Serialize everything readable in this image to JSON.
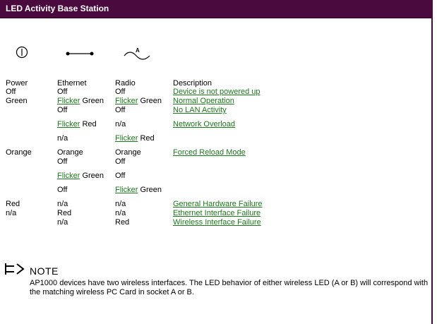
{
  "title": "LED Activity Base Station",
  "icons": [
    "power-icon",
    "ethernet-icon",
    "radio-icon"
  ],
  "radio_icon_letter": "A",
  "headers": {
    "power": "Power",
    "ethernet": "Ethernet",
    "radio": "Radio",
    "description": "Description"
  },
  "rows": [
    {
      "power": "Off",
      "eth_a": "",
      "eth_b": "Off",
      "radio_a": "",
      "radio_b": "Off",
      "desc": "Device is not powered up"
    },
    {
      "power": "Green",
      "eth_a": "Flicker",
      "eth_b": "Green",
      "radio_a": "Flicker",
      "radio_b": "Green",
      "desc": "Normal Operation"
    },
    {
      "power": "",
      "eth_a": "",
      "eth_b": "Off",
      "radio_a": "",
      "radio_b": "Off",
      "desc": "No LAN Activity"
    },
    {
      "power": "",
      "eth_a": "Flicker",
      "eth_b": "Red",
      "radio_a": "",
      "radio_b": "n/a",
      "desc": "Network Overload"
    },
    {
      "power": "",
      "eth_a": "",
      "eth_b": "n/a",
      "radio_a": "Flicker",
      "radio_b": "Red",
      "desc": ""
    },
    {
      "power": "Orange",
      "eth_a": "",
      "eth_b": "Orange",
      "radio_a": "",
      "radio_b": "Orange",
      "desc": "Forced Reload Mode"
    },
    {
      "power": "",
      "eth_a": "",
      "eth_b": "Off",
      "radio_a": "",
      "radio_b": "Off",
      "desc": ""
    },
    {
      "power": "",
      "eth_a": "Flicker",
      "eth_b": "Green",
      "radio_a": "",
      "radio_b": "Off",
      "desc": ""
    },
    {
      "power": "",
      "eth_a": "",
      "eth_b": "Off",
      "radio_a": "Flicker",
      "radio_b": "Green",
      "desc": ""
    },
    {
      "power": "Red",
      "eth_a": "",
      "eth_b": "n/a",
      "radio_a": "",
      "radio_b": "n/a",
      "desc": "General Hardware Failure"
    },
    {
      "power": "n/a",
      "eth_a": "",
      "eth_b": "Red",
      "radio_a": "",
      "radio_b": "n/a",
      "desc": "Ethernet Interface Failure"
    },
    {
      "power": "",
      "eth_a": "",
      "eth_b": "n/a",
      "radio_a": "",
      "radio_b": "Red",
      "desc": "Wireless Interface Failure"
    }
  ],
  "note": {
    "title": "NOTE",
    "text": "AP1000 devices have two wireless interfaces. The LED behavior of either wireless LED (A or B) will correspond with the matching wireless PC Card in socket A or B."
  },
  "colors": {
    "titlebar": "#4a0a3e",
    "link": "#1a7a1a"
  }
}
